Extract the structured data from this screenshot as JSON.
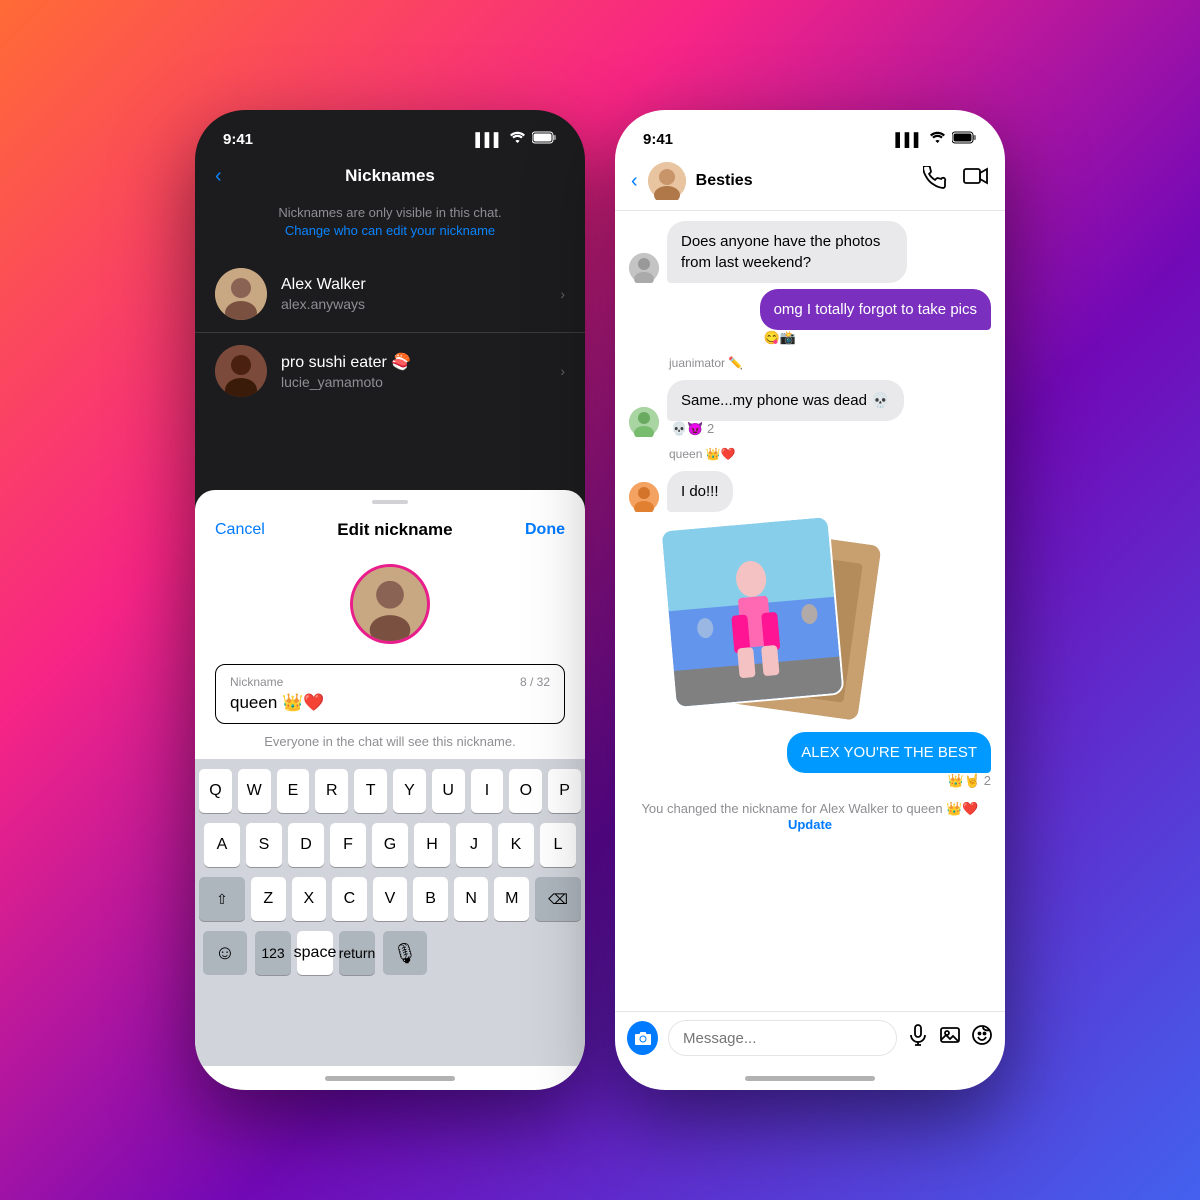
{
  "background": "gradient",
  "left_phone": {
    "status_bar": {
      "time": "9:41",
      "signal": "▌▌▌",
      "wifi": "wifi",
      "battery": "🔋"
    },
    "nicknames_screen": {
      "back_label": "‹",
      "title": "Nicknames",
      "subtitle": "Nicknames are only visible in this chat.",
      "change_link": "Change who can edit your nickname",
      "contacts": [
        {
          "name": "Alex Walker",
          "username": "alex.anyways"
        },
        {
          "name": "pro sushi eater 🍣",
          "username": "lucie_yamamoto"
        }
      ]
    },
    "bottom_sheet": {
      "cancel_label": "Cancel",
      "title": "Edit nickname",
      "done_label": "Done",
      "nickname_label": "Nickname",
      "nickname_value": "queen 👑❤️",
      "char_count": "8 / 32",
      "hint": "Everyone in the chat will see this nickname."
    },
    "keyboard": {
      "rows": [
        [
          "Q",
          "W",
          "E",
          "R",
          "T",
          "Y",
          "U",
          "I",
          "O",
          "P"
        ],
        [
          "A",
          "S",
          "D",
          "F",
          "G",
          "H",
          "J",
          "K",
          "L"
        ],
        [
          "⇧",
          "Z",
          "X",
          "C",
          "V",
          "B",
          "N",
          "M",
          "⌫"
        ],
        [
          "123",
          "space",
          "return"
        ]
      ],
      "emoji_key": "☺",
      "mic_key": "🎙"
    }
  },
  "right_phone": {
    "status_bar": {
      "time": "9:41"
    },
    "chat": {
      "group_name": "Besties",
      "messages": [
        {
          "type": "received",
          "text": "Does anyone have the photos from last weekend?",
          "sender": "gray"
        },
        {
          "type": "sent",
          "text": "omg I totally forgot to take pics",
          "reactions": "😋📸"
        },
        {
          "type": "sender_label",
          "text": "juanimator ✏️"
        },
        {
          "type": "received",
          "text": "Same...my phone was dead 💀",
          "reactions": "💀😈 2",
          "sender": "green"
        },
        {
          "type": "sender_label",
          "text": "queen 👑❤️"
        },
        {
          "type": "received",
          "text": "I do!!!",
          "sender": "orange"
        },
        {
          "type": "photo_stack"
        },
        {
          "type": "sent_blue",
          "text": "ALEX YOU'RE THE BEST",
          "reactions": "👑🤘 2"
        }
      ],
      "system_message": "You changed the nickname for Alex Walker to queen 👑❤️",
      "update_link": "Update",
      "input_placeholder": "Message..."
    }
  }
}
